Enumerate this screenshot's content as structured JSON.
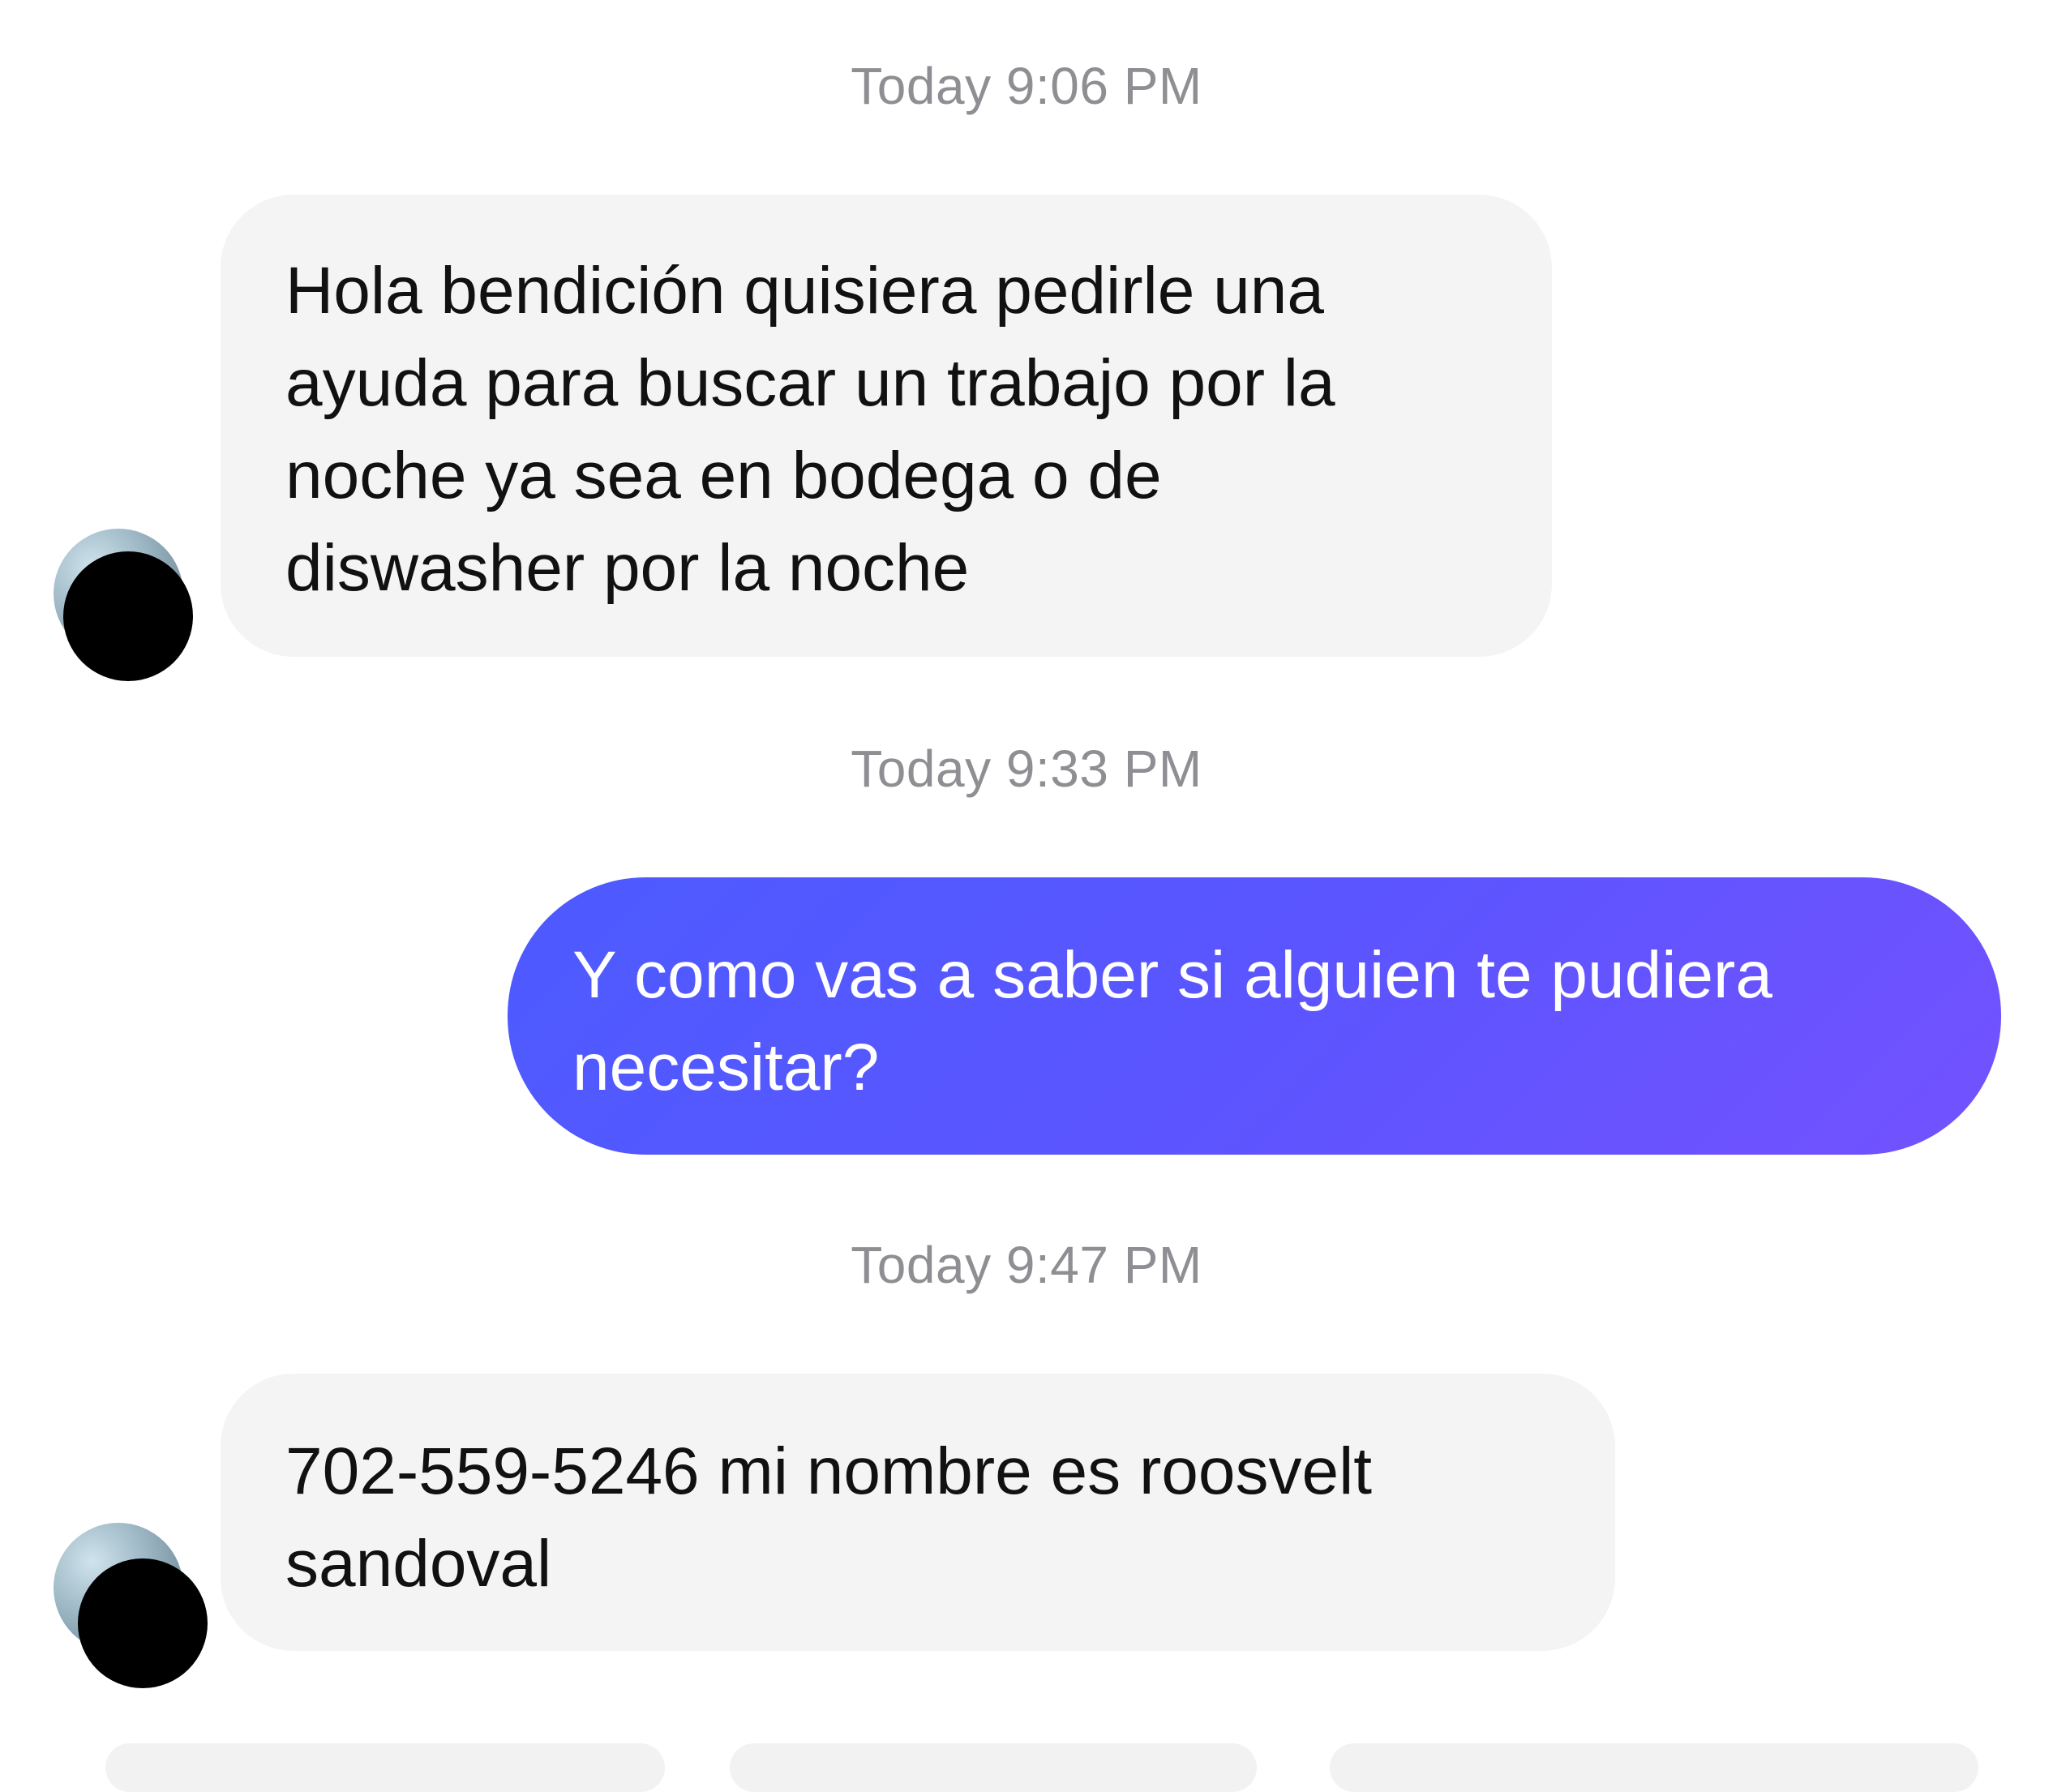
{
  "thread": {
    "messages": [
      {
        "timestamp": "Today 9:06 PM",
        "direction": "incoming",
        "text": "Hola bendición quisiera pedirle una\nayuda para buscar un trabajo por la\nnoche ya sea en bodega o de\ndiswasher por la noche"
      },
      {
        "timestamp": "Today 9:33 PM",
        "direction": "outgoing",
        "text": "Y como vas a saber si alguien te pudiera\nnecesitar?"
      },
      {
        "timestamp": "Today 9:47 PM",
        "direction": "incoming",
        "text": "702-559-5246 mi nombre es roosvelt\nsandoval"
      }
    ]
  },
  "colors": {
    "incoming_bubble": "#f4f4f4",
    "outgoing_gradient_start": "#4c5bff",
    "outgoing_gradient_end": "#7352ff",
    "timestamp_text": "#8e8e93"
  }
}
